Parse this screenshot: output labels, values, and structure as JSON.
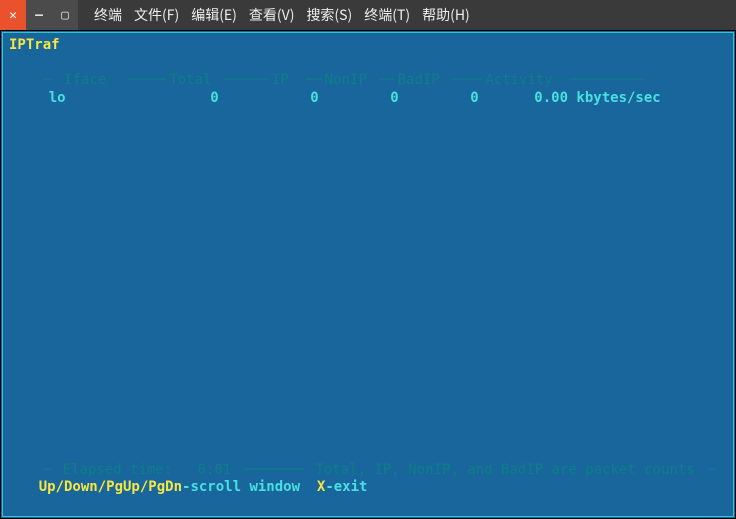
{
  "window": {
    "close_glyph": "✕",
    "min_glyph": "—",
    "max_glyph": "▢"
  },
  "menu": {
    "items": [
      "终端",
      "文件(F)",
      "编辑(E)",
      "查看(V)",
      "搜索(S)",
      "终端(T)",
      "帮助(H)"
    ]
  },
  "app": {
    "title": "IPTraf"
  },
  "columns": {
    "iface": "Iface",
    "total": "Total",
    "ip": "IP",
    "nonip": "NonIP",
    "badip": "BadIP",
    "activity": "Activity"
  },
  "rows": [
    {
      "iface": "lo",
      "total": "0",
      "ip": "0",
      "nonip": "0",
      "badip": "0",
      "activity": "0.00 kbytes/sec"
    }
  ],
  "footer": {
    "elapsed_label": "Elapsed time:",
    "elapsed_value": "0:01",
    "note": "Total, IP, NonIP, and BadIP are packet counts",
    "keys_updown": "Up/Down/PgUp/PgDn",
    "scroll_text": "-scroll window  ",
    "key_x": "X",
    "exit_text": "-exit"
  }
}
